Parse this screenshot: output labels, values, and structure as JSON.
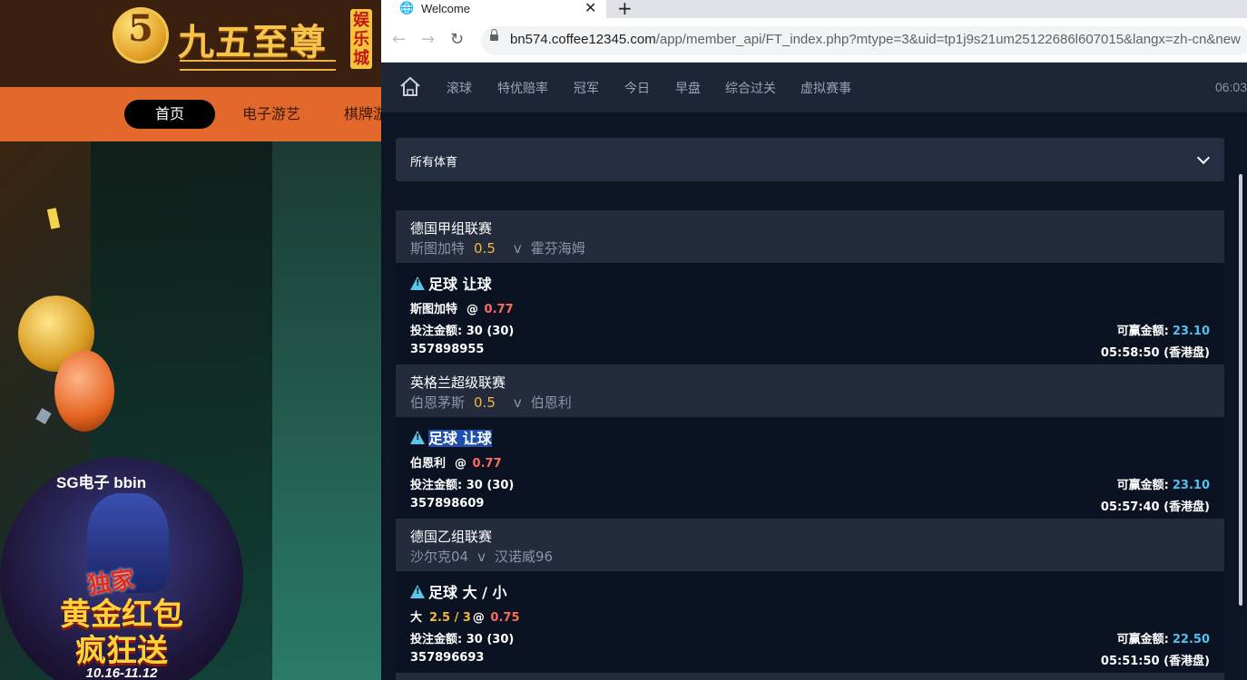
{
  "background_site": {
    "logo_numeral": "5",
    "logo_text": "九五至尊",
    "logo_badge": "娱乐城",
    "nav": {
      "home": "首页",
      "egame": "电子游艺",
      "chess": "棋牌游"
    },
    "promo": {
      "brands": "SG电子  bbin",
      "tag": "独家",
      "title_line1": "黄金红包",
      "title_line2": "疯狂送",
      "date": "10.16-11.12"
    }
  },
  "browser": {
    "tab_title": "Welcome",
    "tab_close": "✕",
    "new_tab": "+",
    "back": "←",
    "forward": "→",
    "reload": "↻",
    "url_host": "bn574.coffee12345.com",
    "url_path": "/app/member_api/FT_index.php?mtype=3&uid=tp1j9s21um25122686l607015&langx=zh-cn&new"
  },
  "app": {
    "nav": [
      "滚球",
      "特优赔率",
      "冠军",
      "今日",
      "早盘",
      "综合过关",
      "虚拟赛事"
    ],
    "clock": "06:03",
    "sport_filter": "所有体育",
    "bets": [
      {
        "league": "德国甲组联赛",
        "home": "斯图加特",
        "handicap": "0.5",
        "vs": "v",
        "away": "霍芬海姆",
        "bet_type": "足球 让球",
        "pick": "斯图加特",
        "line": "",
        "at": "@",
        "odds": "0.77",
        "stake_label": "投注金额:",
        "stake": "30 (30)",
        "win_label": "可赢金额:",
        "win": "23.10",
        "ticket": "357898955",
        "time": "05:58:50 (香港盘)"
      },
      {
        "league": "英格兰超级联赛",
        "home": "伯恩茅斯",
        "handicap": "0.5",
        "vs": "v",
        "away": "伯恩利",
        "bet_type": "足球 让球",
        "pick": "伯恩利",
        "line": "",
        "at": "@",
        "odds": "0.77",
        "stake_label": "投注金额:",
        "stake": "30 (30)",
        "win_label": "可赢金额:",
        "win": "23.10",
        "ticket": "357898609",
        "time": "05:57:40 (香港盘)"
      },
      {
        "league": "德国乙组联赛",
        "home": "沙尔克04",
        "handicap": "",
        "vs": "v",
        "away": "汉诺威96",
        "bet_type": "足球 大 / 小",
        "pick": "大",
        "line": "2.5 / 3",
        "at": "@",
        "odds": "0.75",
        "stake_label": "投注金额:",
        "stake": "30 (30)",
        "win_label": "可赢金额:",
        "win": "22.50",
        "ticket": "357896693",
        "time": "05:51:50 (香港盘)"
      }
    ]
  },
  "colors": {
    "nav_bg": "#1e2537",
    "league_bg": "#232b3d",
    "odds_red": "#ff6b5b",
    "handicap_yellow": "#f5b73b",
    "win_blue": "#4fc3ef",
    "warn_cyan": "#5bc6e8"
  }
}
